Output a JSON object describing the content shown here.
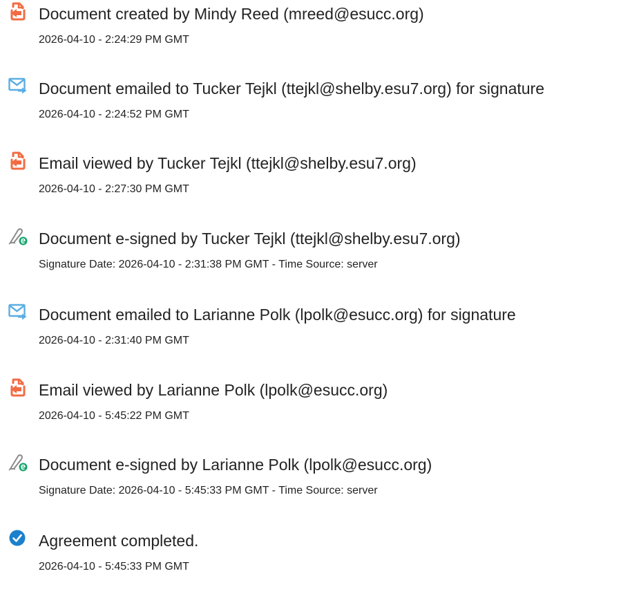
{
  "events": [
    {
      "icon": "document-created-icon",
      "title": "Document created by Mindy Reed (mreed@esucc.org)",
      "date": "2026-04-10 - 2:24:29 PM GMT"
    },
    {
      "icon": "email-sent-icon",
      "title": "Document emailed to Tucker Tejkl (ttejkl@shelby.esu7.org) for signature",
      "date": "2026-04-10 - 2:24:52 PM GMT"
    },
    {
      "icon": "email-viewed-icon",
      "title": "Email viewed by Tucker Tejkl (ttejkl@shelby.esu7.org)",
      "date": "2026-04-10 - 2:27:30 PM GMT"
    },
    {
      "icon": "e-signed-icon",
      "title": "Document e-signed by Tucker Tejkl (ttejkl@shelby.esu7.org)",
      "date": "Signature Date: 2026-04-10 - 2:31:38 PM GMT - Time Source: server"
    },
    {
      "icon": "email-sent-icon",
      "title": "Document emailed to Larianne Polk (lpolk@esucc.org) for signature",
      "date": "2026-04-10 - 2:31:40 PM GMT"
    },
    {
      "icon": "email-viewed-icon",
      "title": "Email viewed by Larianne Polk (lpolk@esucc.org)",
      "date": "2026-04-10 - 5:45:22 PM GMT"
    },
    {
      "icon": "e-signed-icon",
      "title": "Document e-signed by Larianne Polk (lpolk@esucc.org)",
      "date": "Signature Date: 2026-04-10 - 5:45:33 PM GMT - Time Source: server"
    },
    {
      "icon": "check-circle-icon",
      "title": "Agreement completed.",
      "date": "2026-04-10 - 5:45:33 PM GMT"
    }
  ],
  "colors": {
    "document_icon": "#f26b43",
    "email_icon": "#5aaee3",
    "check_icon": "#1c80cc",
    "sign_icon_green": "#15a36c",
    "sign_icon_gray": "#8a8a8a",
    "text": "#232323"
  }
}
